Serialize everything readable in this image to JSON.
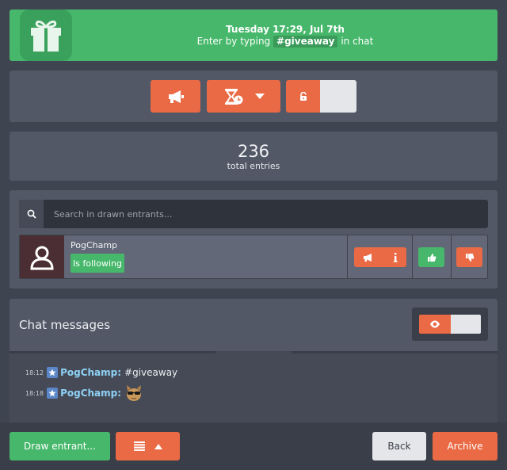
{
  "banner": {
    "datetime": "Tuesday 17:29, Jul 7th",
    "enter_prefix": "Enter by typing",
    "keyword": "#giveaway",
    "enter_suffix": "in chat",
    "icon": "gift-icon"
  },
  "controls": {
    "announce_icon": "megaphone-icon",
    "timer_icon": "hourglass-clock-icon",
    "timer_dropdown_icon": "caret-down-icon",
    "lock_icon": "unlock-icon"
  },
  "stats": {
    "total": "236",
    "label": "total entries"
  },
  "entrants": {
    "search_placeholder": "Search in drawn entrants...",
    "list": [
      {
        "name": "PogChamp",
        "status": "Is following",
        "avatar_icon": "user-icon"
      }
    ]
  },
  "chat": {
    "title": "Chat messages",
    "visibility_icon": "eye-icon",
    "messages": [
      {
        "time": "18:12",
        "user": "PogChamp:",
        "text": "#giveaway"
      },
      {
        "time": "18:18",
        "user": "PogChamp:",
        "text": "",
        "emote": "cat-sunglasses-emote"
      }
    ]
  },
  "footer": {
    "draw_label": "Draw entrant...",
    "back_label": "Back",
    "archive_label": "Archive"
  },
  "colors": {
    "green": "#47b86b",
    "orange": "#ea6a45",
    "username": "#8ed1f5"
  }
}
